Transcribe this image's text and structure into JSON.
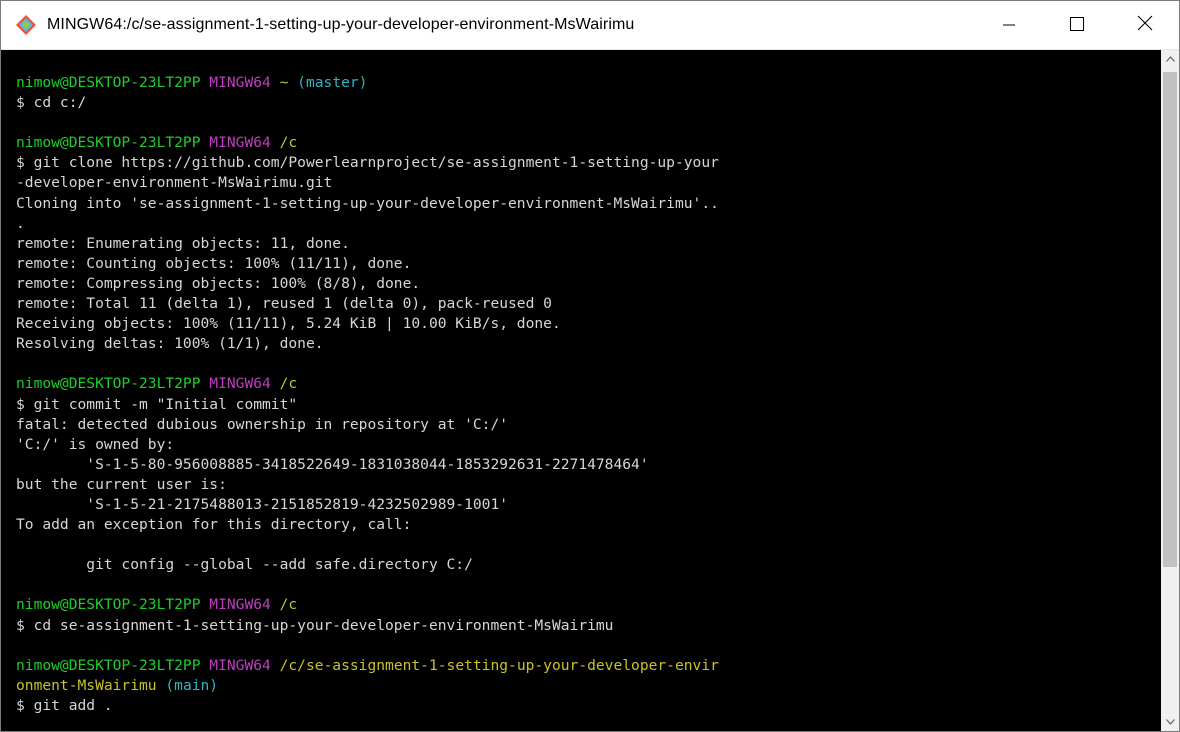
{
  "window": {
    "title": "MINGW64:/c/se-assignment-1-setting-up-your-developer-environment-MsWairimu",
    "icon": "git-bash-icon",
    "controls": {
      "minimize": "minimize-icon",
      "maximize": "maximize-icon",
      "close": "close-icon"
    }
  },
  "colors": {
    "background": "#000000",
    "text": "#d6d6d6",
    "user_host": "#1ecf2b",
    "shell": "#c03cc0",
    "path": "#c9c22a",
    "branch": "#29b6c6"
  },
  "terminal": {
    "lines": [
      [
        {
          "t": "nimow@DESKTOP-23LT2PP ",
          "c": "green"
        },
        {
          "t": "MINGW64 ",
          "c": "magenta"
        },
        {
          "t": "~ ",
          "c": "yellow"
        },
        {
          "t": "(master)",
          "c": "cyan"
        }
      ],
      [
        {
          "t": "$ cd c:/"
        }
      ],
      [],
      [
        {
          "t": "nimow@DESKTOP-23LT2PP ",
          "c": "green"
        },
        {
          "t": "MINGW64 ",
          "c": "magenta"
        },
        {
          "t": "/c",
          "c": "yellow"
        }
      ],
      [
        {
          "t": "$ git clone https://github.com/Powerlearnproject/se-assignment-1-setting-up-your"
        }
      ],
      [
        {
          "t": "-developer-environment-MsWairimu.git"
        }
      ],
      [
        {
          "t": "Cloning into 'se-assignment-1-setting-up-your-developer-environment-MsWairimu'.."
        }
      ],
      [
        {
          "t": "."
        }
      ],
      [
        {
          "t": "remote: Enumerating objects: 11, done."
        }
      ],
      [
        {
          "t": "remote: Counting objects: 100% (11/11), done."
        }
      ],
      [
        {
          "t": "remote: Compressing objects: 100% (8/8), done."
        }
      ],
      [
        {
          "t": "remote: Total 11 (delta 1), reused 1 (delta 0), pack-reused 0"
        }
      ],
      [
        {
          "t": "Receiving objects: 100% (11/11), 5.24 KiB | 10.00 KiB/s, done."
        }
      ],
      [
        {
          "t": "Resolving deltas: 100% (1/1), done."
        }
      ],
      [],
      [
        {
          "t": "nimow@DESKTOP-23LT2PP ",
          "c": "green"
        },
        {
          "t": "MINGW64 ",
          "c": "magenta"
        },
        {
          "t": "/c",
          "c": "yellow"
        }
      ],
      [
        {
          "t": "$ git commit -m \"Initial commit\""
        }
      ],
      [
        {
          "t": "fatal: detected dubious ownership in repository at 'C:/'"
        }
      ],
      [
        {
          "t": "'C:/' is owned by:"
        }
      ],
      [
        {
          "t": "        'S-1-5-80-956008885-3418522649-1831038044-1853292631-2271478464'"
        }
      ],
      [
        {
          "t": "but the current user is:"
        }
      ],
      [
        {
          "t": "        'S-1-5-21-2175488013-2151852819-4232502989-1001'"
        }
      ],
      [
        {
          "t": "To add an exception for this directory, call:"
        }
      ],
      [],
      [
        {
          "t": "        git config --global --add safe.directory C:/"
        }
      ],
      [],
      [
        {
          "t": "nimow@DESKTOP-23LT2PP ",
          "c": "green"
        },
        {
          "t": "MINGW64 ",
          "c": "magenta"
        },
        {
          "t": "/c",
          "c": "yellow"
        }
      ],
      [
        {
          "t": "$ cd se-assignment-1-setting-up-your-developer-environment-MsWairimu"
        }
      ],
      [],
      [
        {
          "t": "nimow@DESKTOP-23LT2PP ",
          "c": "green"
        },
        {
          "t": "MINGW64 ",
          "c": "magenta"
        },
        {
          "t": "/c/se-assignment-1-setting-up-your-developer-envir",
          "c": "yellow"
        }
      ],
      [
        {
          "t": "onment-MsWairimu ",
          "c": "yellow"
        },
        {
          "t": "(main)",
          "c": "cyan"
        }
      ],
      [
        {
          "t": "$ git add ."
        }
      ]
    ]
  },
  "scrollbar": {
    "up": "scroll-up-arrow-icon",
    "down": "scroll-down-arrow-icon"
  }
}
